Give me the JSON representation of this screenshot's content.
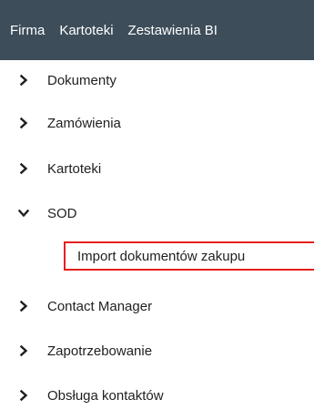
{
  "topbar": {
    "items": [
      "Firma",
      "Kartoteki",
      "Zestawienia BI"
    ]
  },
  "menu": {
    "items": [
      {
        "label": "Dokumenty",
        "expanded": false
      },
      {
        "label": "Zamówienia",
        "expanded": false
      },
      {
        "label": "Kartoteki",
        "expanded": false
      },
      {
        "label": "SOD",
        "expanded": true
      },
      {
        "label": "Contact Manager",
        "expanded": false
      },
      {
        "label": "Zapotrzebowanie",
        "expanded": false
      },
      {
        "label": "Obsługa kontaktów",
        "expanded": false
      }
    ],
    "sod_children": [
      {
        "label": "Import dokumentów zakupu",
        "highlighted": true
      }
    ]
  },
  "colors": {
    "topbar_bg": "#3d4d59",
    "highlight_border": "#e51f1f",
    "text": "#1f1f1f"
  },
  "icons": {
    "collapsed": "chevron-right-icon",
    "expanded": "chevron-down-icon"
  }
}
